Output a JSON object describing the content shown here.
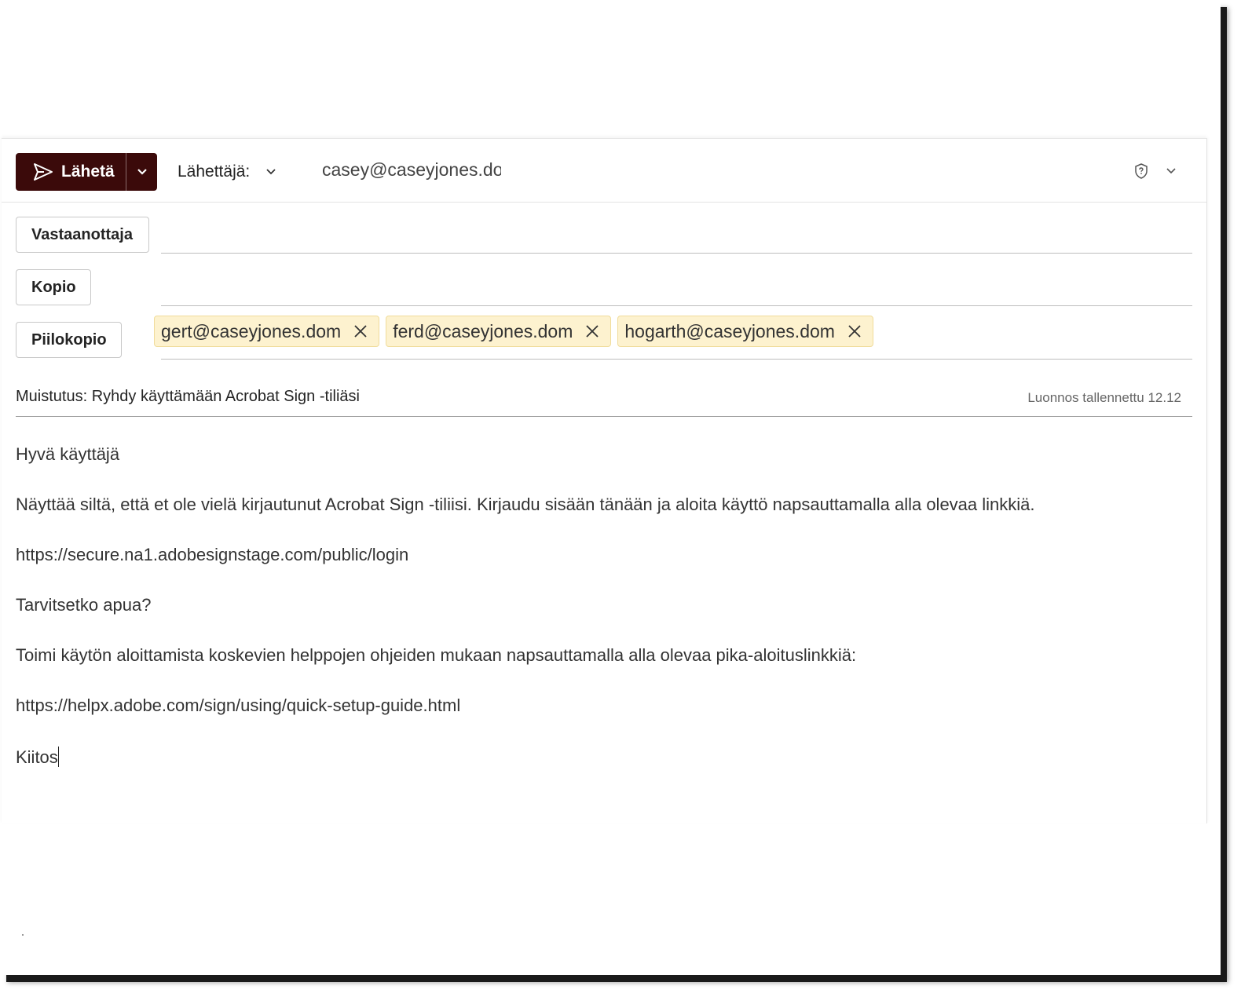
{
  "toolbar": {
    "send_label": "Lähetä",
    "from_label": "Lähettäjä:",
    "from_value": "casey@caseyjones.dom"
  },
  "recipients": {
    "to_label": "Vastaanottaja",
    "cc_label": "Kopio",
    "bcc_label": "Piilokopio",
    "bcc_chips": [
      "gert@caseyjones.dom",
      "ferd@caseyjones.dom",
      "hogarth@caseyjones.dom"
    ]
  },
  "subject": "Muistutus: Ryhdy käyttämään Acrobat Sign -tiliäsi",
  "draft_status": "Luonnos tallennettu 12.12",
  "body": {
    "greeting": "Hyvä käyttäjä",
    "paragraph1": "Näyttää siltä, että et ole vielä kirjautunut Acrobat Sign -tiliisi. Kirjaudu sisään tänään ja aloita käyttö napsauttamalla alla olevaa linkkiä.",
    "link1": "https://secure.na1.adobesignstage.com/public/login",
    "help_question": "Tarvitsetko apua?",
    "paragraph2": "Toimi käytön aloittamista koskevien helppojen ohjeiden mukaan napsauttamalla alla olevaa pika-aloituslinkkiä:",
    "link2": "https://helpx.adobe.com/sign/using/quick-setup-guide.html",
    "signoff": "Kiitos"
  },
  "colors": {
    "send_button": "#3b0a0a",
    "chip_background": "#fdf2cf"
  },
  "icons": [
    "send-icon",
    "chevron-down-icon",
    "shield-question-icon",
    "close-icon"
  ]
}
